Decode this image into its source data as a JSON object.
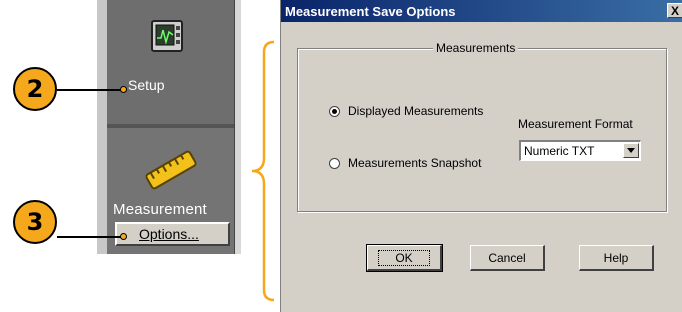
{
  "panel": {
    "setup_label": "Setup",
    "measurement_label": "Measurement",
    "options_button": "Options...",
    "setup_icon": "oscilloscope-screen-icon",
    "measurement_icon": "ruler-icon"
  },
  "callouts": [
    "2",
    "3"
  ],
  "dialog": {
    "title": "Measurement Save Options",
    "close_label": "X",
    "group_label": "Measurements",
    "radio_displayed": "Displayed Measurements",
    "radio_snapshot": "Measurements Snapshot",
    "selected_radio": "Displayed Measurements",
    "format_label": "Measurement Format",
    "format_value": "Numeric TXT",
    "ok_label": "OK",
    "cancel_label": "Cancel",
    "help_label": "Help"
  },
  "colors": {
    "callout": "#f5a81c",
    "titlebar": "#0a246a",
    "dialog_bg": "#d4d0c8"
  }
}
